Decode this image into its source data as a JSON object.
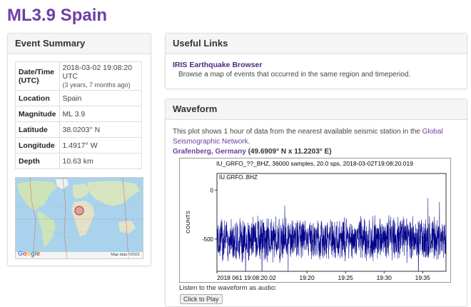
{
  "page": {
    "title": "ML3.9 Spain"
  },
  "summary": {
    "heading": "Event Summary",
    "rows": [
      {
        "key": "Date/Time (UTC)",
        "value": "2018-03-02 19:08:20 UTC",
        "ago": "(3 years, 7 months ago)"
      },
      {
        "key": "Location",
        "value": "Spain"
      },
      {
        "key": "Magnitude",
        "value": "ML 3.9"
      },
      {
        "key": "Latitude",
        "value": "38.0203° N"
      },
      {
        "key": "Longitude",
        "value": "1.4917° W"
      },
      {
        "key": "Depth",
        "value": "10.63 km"
      }
    ],
    "map": {
      "logo": "Google",
      "attribution": "Map data ©2021"
    }
  },
  "links": {
    "heading": "Useful Links",
    "items": [
      {
        "title": "IRIS Earthquake Browser",
        "description": "Browse a map of events that occurred in the same region and timeperiod."
      }
    ]
  },
  "waveform": {
    "heading": "Waveform",
    "description_pre": "This plot shows 1 hour of data from the nearest available seismic station in the ",
    "description_link": "Global Seismographic Network",
    "description_post": ".",
    "station_name": "Grafenberg, Germany",
    "station_coords": "(49.6909° N x 11.2203° E)",
    "listen_text": "Listen to the waveform as audio:",
    "play_button": "Click to Play"
  },
  "chart_data": {
    "type": "line",
    "title": "IU_GRFO_??_BHZ, 36000 samples, 20.0 sps, 2018-03-02T19:08:20.019",
    "trace_label": "IU.GRFO..BHZ",
    "ylabel": "COUNTS",
    "xlabel": "",
    "x_ticks": [
      "2018 061 19:08:20.02",
      "19:20",
      "19:25",
      "19:30",
      "19:35"
    ],
    "x_tick_minutes": [
      0,
      11.67,
      16.67,
      21.67,
      26.67
    ],
    "xlim_minutes": [
      0,
      29.7
    ],
    "y_ticks": [
      0,
      -500
    ],
    "ylim": [
      -830,
      170
    ],
    "baseline": -500,
    "amplitude": 250,
    "peak_amplitude": 560,
    "samples": 36000,
    "sps": 20.0,
    "color": "#00008b"
  }
}
